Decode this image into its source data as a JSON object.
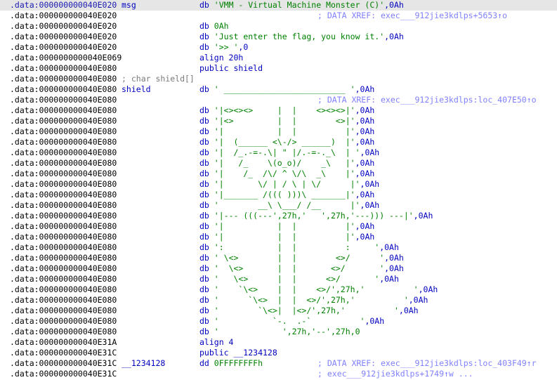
{
  "window": {
    "title": ""
  },
  "colors": {
    "address": "#808080",
    "mnemonic": "#0000c0",
    "string": "#008000",
    "xref": "#8080ff",
    "selected_row": "#e6e6e6"
  },
  "rows": [
    {
      "addr": ".data:000000000040E020",
      "label": "msg",
      "mnem": "db",
      "str": "'VMM - Virtual Machine Monster (C)'",
      "suffix": ",0Ah"
    },
    {
      "addr": ".data:000000000040E020",
      "xref": "; DATA XREF: exec___912jie3kdlps+5653↑o"
    },
    {
      "addr": ".data:000000000040E020",
      "mnem": "db",
      "num": "0Ah"
    },
    {
      "addr": ".data:000000000040E020",
      "mnem": "db",
      "str": "'Just enter the flag, you know it.'",
      "suffix": ",0Ah"
    },
    {
      "addr": ".data:000000000040E020",
      "mnem": "db",
      "str": "'>> '",
      "suffix": ",0"
    },
    {
      "addr": ".data:0000000000040E069",
      "mnem": "align 20h"
    },
    {
      "addr": ".data:000000000040E080",
      "mnem": "public shield"
    },
    {
      "addr": ".data:000000000040E080",
      "comment": "; char shield[]"
    },
    {
      "addr": ".data:000000000040E080",
      "label": "shield",
      "mnem": "db",
      "str": "' _________________________ '",
      "suffix": ",0Ah"
    },
    {
      "addr": ".data:000000000040E080",
      "xref": "; DATA XREF: exec___912jie3kdlps:loc_407E50↑o"
    },
    {
      "addr": ".data:000000000040E080",
      "mnem": "db",
      "str": "'|<><><>     |  |    <><><>|'",
      "suffix": ",0Ah"
    },
    {
      "addr": ".data:000000000040E080",
      "mnem": "db",
      "str": "'|<>         |  |        <>|'",
      "suffix": ",0Ah"
    },
    {
      "addr": ".data:000000000040E080",
      "mnem": "db",
      "str": "'|           |  |          |'",
      "suffix": ",0Ah"
    },
    {
      "addr": ".data:000000000040E080",
      "mnem": "db",
      "str": "'|  (______ <\\-/> ______)  |'",
      "suffix": ",0Ah"
    },
    {
      "addr": ".data:000000000040E080",
      "mnem": "db",
      "str": "'|  /_.-=-.\\| \" |/.-=-._\\  | '",
      "suffix": ",0Ah"
    },
    {
      "addr": ".data:000000000040E080",
      "mnem": "db",
      "str": "'|   /_    \\(o_o)/    _\\   |'",
      "suffix": ",0Ah"
    },
    {
      "addr": ".data:000000000040E080",
      "mnem": "db",
      "str": "'|    /_  /\\/ ^ \\/\\  _\\    |'",
      "suffix": ",0Ah"
    },
    {
      "addr": ".data:000000000040E080",
      "mnem": "db",
      "str": "'|       \\/ | / \\ | \\/      |'",
      "suffix": ",0Ah"
    },
    {
      "addr": ".data:000000000040E080",
      "mnem": "db",
      "str": "'|_______ /((( )))\\ _______|'",
      "suffix": ",0Ah"
    },
    {
      "addr": ".data:000000000040E080",
      "mnem": "db",
      "str": "'        __\\ \\___/ /__      |'",
      "suffix": ",0Ah"
    },
    {
      "addr": ".data:000000000040E080",
      "mnem": "db",
      "str": "'|--- (((---',27h,'   ',27h,'---))) ---|'",
      "suffix": ",0Ah"
    },
    {
      "addr": ".data:000000000040E080",
      "mnem": "db",
      "str": "'|           |  |          |'",
      "suffix": ",0Ah"
    },
    {
      "addr": ".data:000000000040E080",
      "mnem": "db",
      "str": "'|           |  |          |'",
      "suffix": ",0Ah"
    },
    {
      "addr": ".data:000000000040E080",
      "mnem": "db",
      "str": "':           |  |          :     '",
      "suffix": ",0Ah"
    },
    {
      "addr": ".data:000000000040E080",
      "mnem": "db",
      "str": "' \\<>        |  |        <>/      '",
      "suffix": ",0Ah"
    },
    {
      "addr": ".data:000000000040E080",
      "mnem": "db",
      "str": "'  \\<>       |  |       <>/       '",
      "suffix": ",0Ah"
    },
    {
      "addr": ".data:000000000040E080",
      "mnem": "db",
      "str": "'   \\<>      |  |      <>/       '",
      "suffix": ",0Ah"
    },
    {
      "addr": ".data:000000000040E080",
      "mnem": "db",
      "str": "'    `\\<>    |  |    <>/',27h,'          '",
      "suffix": ",0Ah"
    },
    {
      "addr": ".data:000000000040E080",
      "mnem": "db",
      "str": "'      `\\<>  |  |  <>/',27h,'          '",
      "suffix": ",0Ah"
    },
    {
      "addr": ".data:000000000040E080",
      "mnem": "db",
      "str": "'        `\\<>|  |<>/',27h,'          '",
      "suffix": ",0Ah"
    },
    {
      "addr": ".data:000000000040E080",
      "mnem": "db",
      "str": "'           `-.  .-`          '",
      "suffix": ",0Ah"
    },
    {
      "addr": ".data:000000000040E080",
      "mnem": "db",
      "str": "'             ',27h,'--',27h,0",
      "suffix": ""
    },
    {
      "addr": ".data:000000000040E31A",
      "mnem": "align 4"
    },
    {
      "addr": ".data:000000000040E31C",
      "mnem": "public __1234128"
    },
    {
      "addr": ".data:000000000040E31C",
      "label": "__1234128",
      "mnem": "dd",
      "num": "0FFFFFFFFh",
      "xref": "; DATA XREF: exec___912jie3kdlps:loc_403F49↑r"
    },
    {
      "addr": ".data:000000000040E31C",
      "xref": "; exec___912jie3kdlps+1749↑w ..."
    }
  ]
}
